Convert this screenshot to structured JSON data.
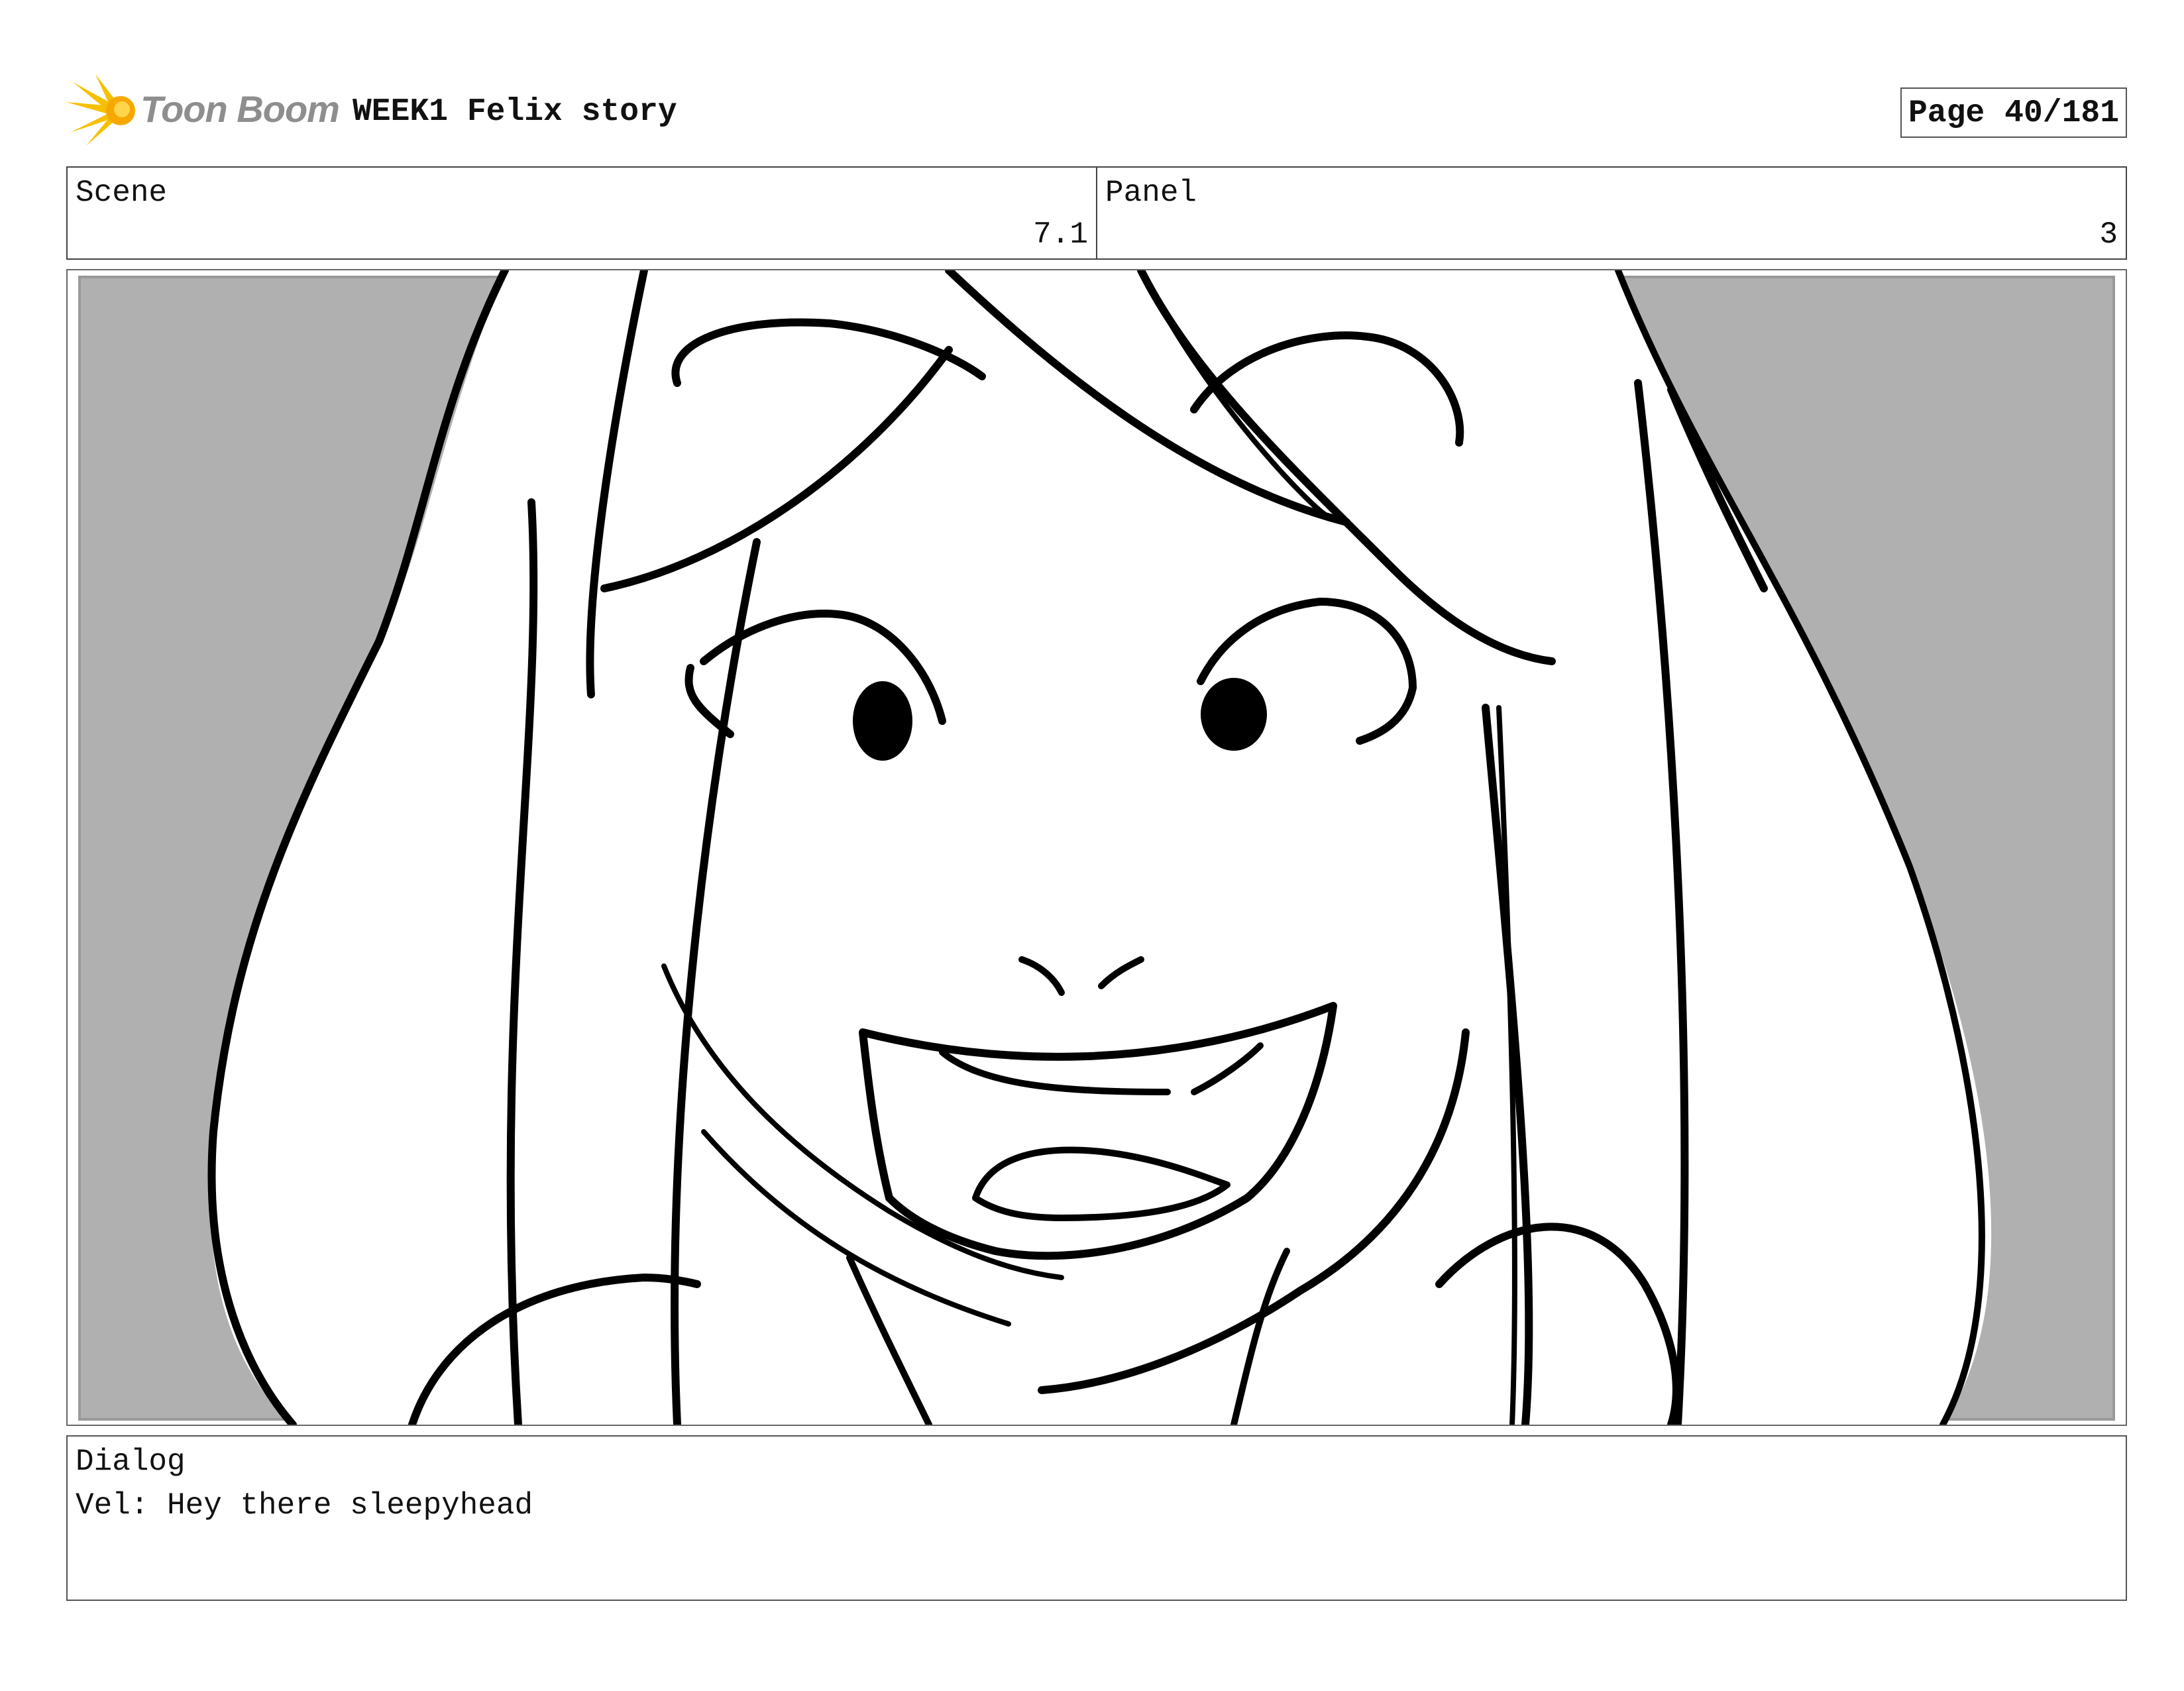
{
  "header": {
    "logo_text": "Toon Boom",
    "project_title": "WEEK1 Felix story",
    "page_label": "Page",
    "page_number": "40/181"
  },
  "scene": {
    "label": "Scene",
    "value": "7.1"
  },
  "panel": {
    "label": "Panel",
    "value": "3"
  },
  "drawing": {
    "subject": "sketch-of-smiling-girl-face",
    "background_color": "#b0b0b0",
    "line_color": "#000000"
  },
  "dialog": {
    "label": "Dialog",
    "text": "Vel: Hey there sleepyhead"
  },
  "colors": {
    "logo_accent": "#f6c000",
    "logo_text": "#8e8e8e"
  }
}
